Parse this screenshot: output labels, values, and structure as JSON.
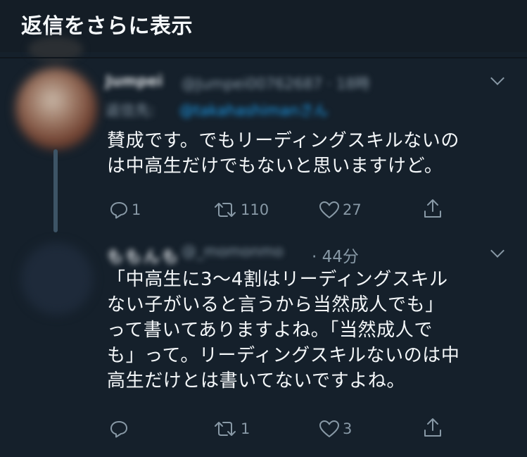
{
  "header": {
    "show_more_replies": "返信をさらに表示"
  },
  "tweets": [
    {
      "author_name": "Jumpei",
      "author_handle": "@Jumpei00762687 · 18時",
      "reply_label": "返信先:",
      "reply_mention": "@takahashimanさん",
      "text_lines": [
        "賛成です。でもリーディングスキルないの",
        "は中高生だけでもないと思いますけど。"
      ],
      "replies": "1",
      "retweets": "110",
      "likes": "27"
    },
    {
      "author_name": "ももんも",
      "author_handle": "@_momonmo",
      "time": "· 44分",
      "text_lines": [
        "「中高生に3〜4割はリーディングスキル",
        "ない子がいると言うから当然成人でも」",
        "って書いてありますよね。「当然成人で",
        "も」って。リーディングスキルないのは中",
        "高生だけとは書いてないですよね。"
      ],
      "replies": "",
      "retweets": "1",
      "likes": "3"
    }
  ],
  "icons": {
    "reply": "reply-icon",
    "retweet": "retweet-icon",
    "like": "heart-icon",
    "share": "share-icon",
    "menu": "chevron-down-icon"
  },
  "colors": {
    "background": "#15202b",
    "header_background": "#141d26",
    "text": "#f5f8fa",
    "secondary_text": "#8899a6",
    "link": "#1da1f2",
    "thread_line": "#3d5466"
  }
}
